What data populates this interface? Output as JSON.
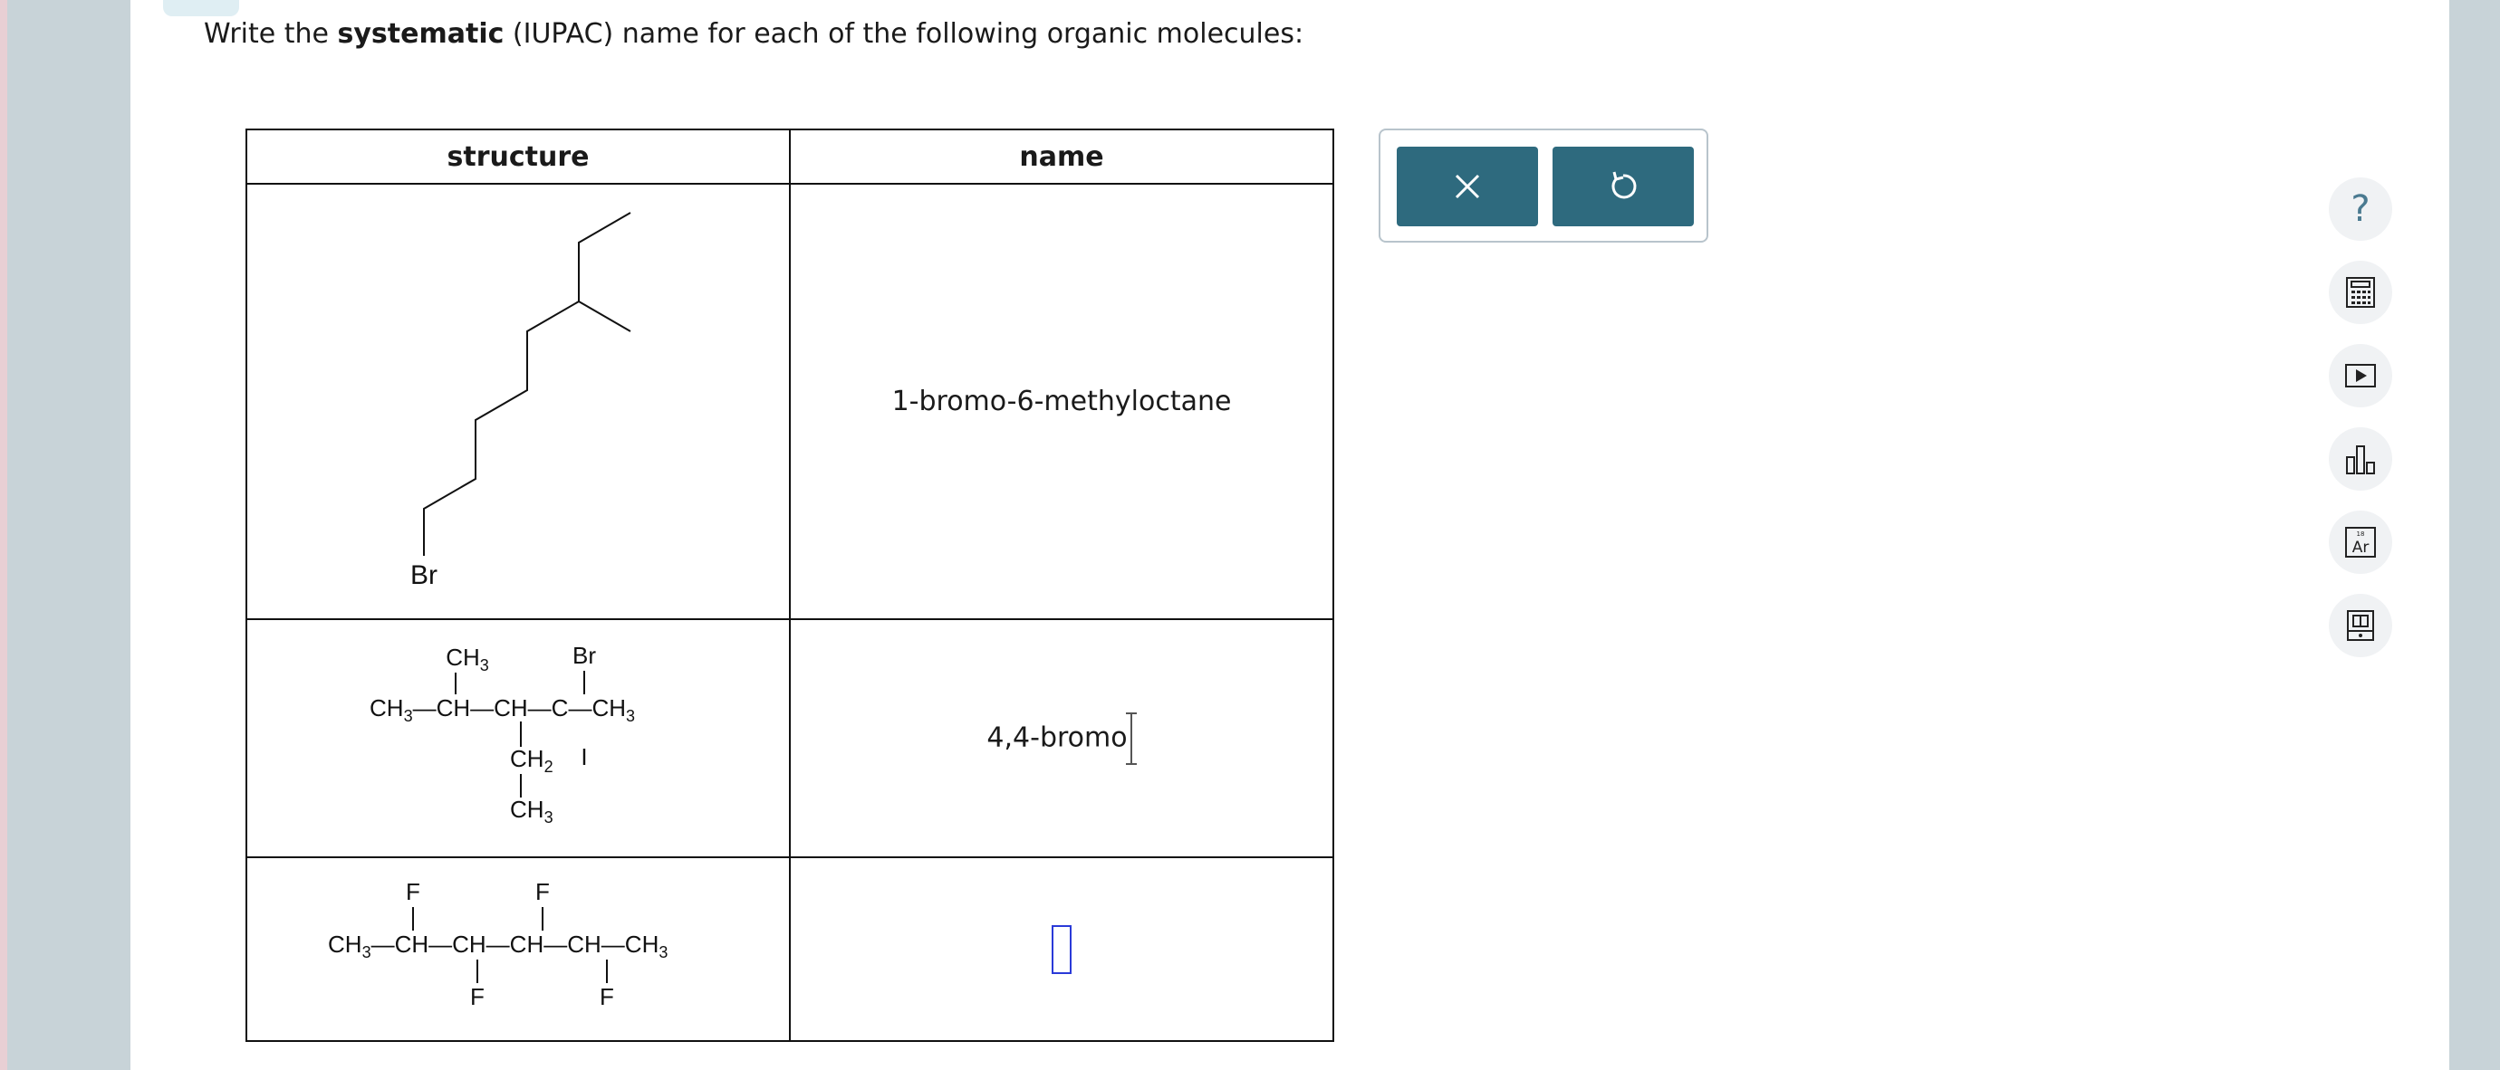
{
  "instructions": {
    "prefix": "Write the ",
    "bold": "systematic",
    "suffix": " (IUPAC) name for each of the following organic molecules:"
  },
  "table": {
    "headers": [
      "structure",
      "name"
    ],
    "rows": [
      {
        "structure_labels": {
          "br": "Br"
        },
        "name": "1-bromo-6-methyloctane"
      },
      {
        "structure_labels": {
          "ch3_top": "CH3",
          "br_top": "Br",
          "main_chain": "CH3—CH—CH—C—CH3",
          "ch2": "CH2",
          "ch3_bottom": "CH3",
          "i_sub": "I"
        },
        "name": "4,4-bromo"
      },
      {
        "structure_labels": {
          "f1": "F",
          "f2": "F",
          "f3": "F",
          "f4": "F",
          "main_chain": "CH3—CH—CH—CH—CH—CH3"
        },
        "name": ""
      }
    ]
  },
  "actions": {
    "clear_icon": "close-icon",
    "undo_icon": "undo-icon"
  },
  "tools": {
    "help_label": "?",
    "icons": [
      "help-icon",
      "calculator-icon",
      "video-icon",
      "chart-icon",
      "periodic-table-icon",
      "reference-book-icon"
    ],
    "periodic_symbol": "Ar",
    "periodic_number": "18"
  },
  "colors": {
    "button": "#2e6a7e",
    "input_outline": "#2a3ad8",
    "gutter": "#c8d3d8"
  }
}
